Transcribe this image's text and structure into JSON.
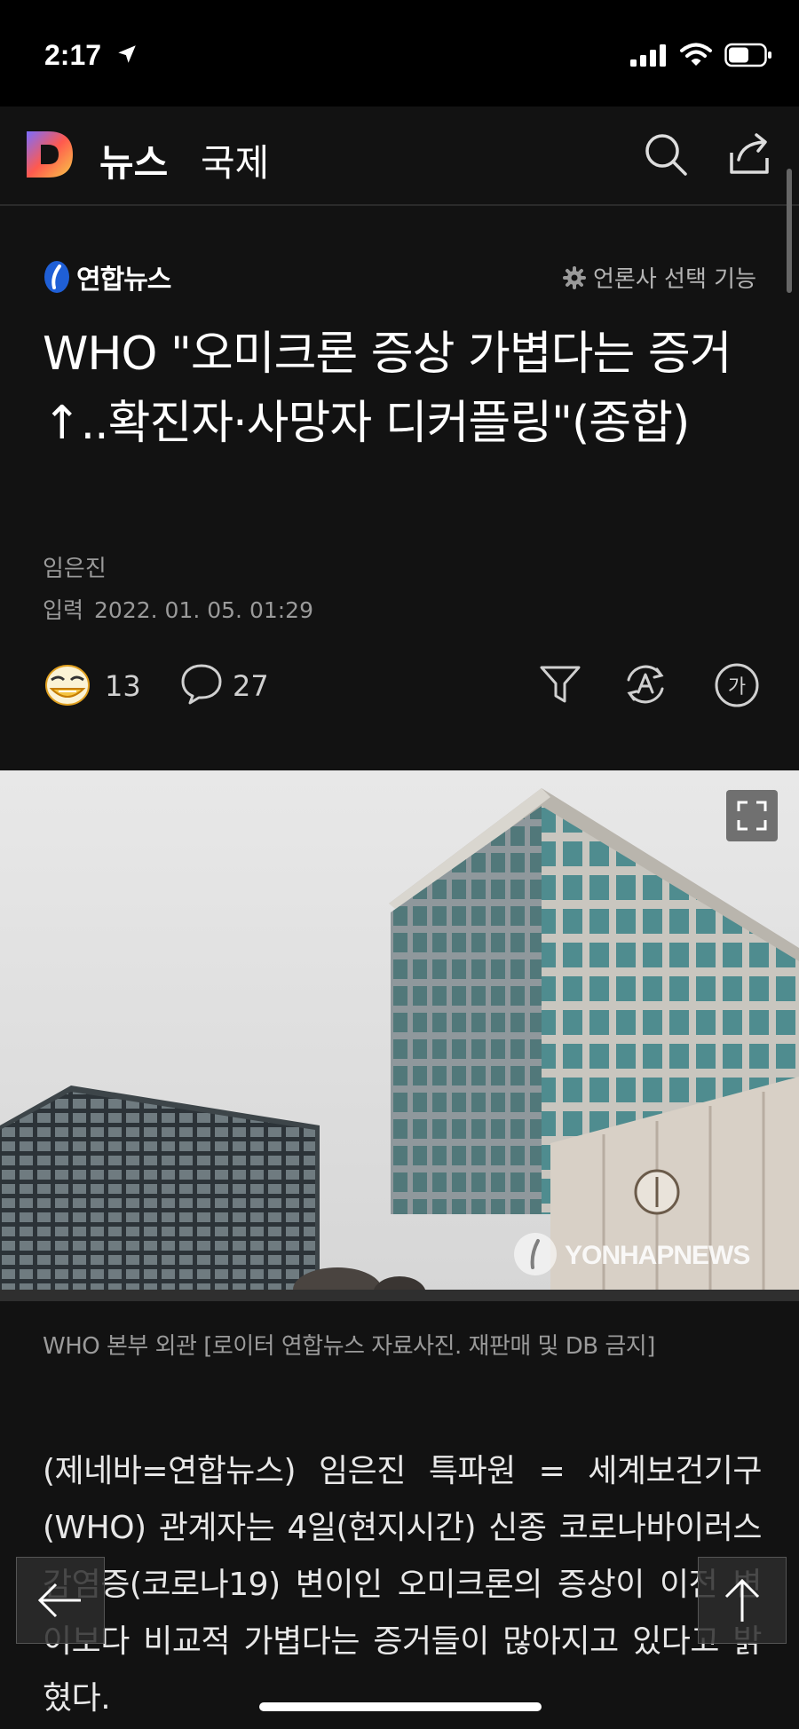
{
  "status_bar": {
    "time": "2:17"
  },
  "app_bar": {
    "section": "뉴스",
    "category": "국제"
  },
  "press": {
    "name": "연합뉴스",
    "select_label": "언론사 선택 기능"
  },
  "article": {
    "headline": "WHO \"오미크론 증상 가볍다는 증거↑..확진자·사망자 디커플링\"(종합)",
    "reporter": "임은진",
    "date_label": "입력",
    "date_value": "2022. 01. 05. 01:29",
    "reactions_count": "13",
    "comments_count": "27",
    "font_button_label": "가",
    "photo_watermark": "YONHAPNEWS",
    "photo_caption": "WHO 본부 외관 [로이터 연합뉴스 자료사진. 재판매 및 DB 금지]",
    "body": "(제네바=연합뉴스) 임은진 특파원 = 세계보건기구(WHO) 관계자는 4일(현지시간) 신종 코로나바이러스 감염증(코로나19) 변이인 오미크론의 증상이 이전 변이보다 비교적 가볍다는 증거들이 많아지고 있다고 밝혔다."
  },
  "icons": {
    "logo": "daum-d-logo",
    "search": "search-icon",
    "share": "share-icon",
    "emotion": "emoji-face-icon",
    "comment": "comment-icon",
    "filter": "filter-icon",
    "tts": "text-to-speech-icon",
    "font_size": "font-size-icon",
    "expand": "expand-icon",
    "back": "back-arrow-icon",
    "top": "scroll-top-icon"
  },
  "colors": {
    "background": "#121212",
    "logo_gradient_start": "#ff6a3d",
    "logo_gradient_end": "#f5c542",
    "press_blue": "#1f5fd6"
  }
}
